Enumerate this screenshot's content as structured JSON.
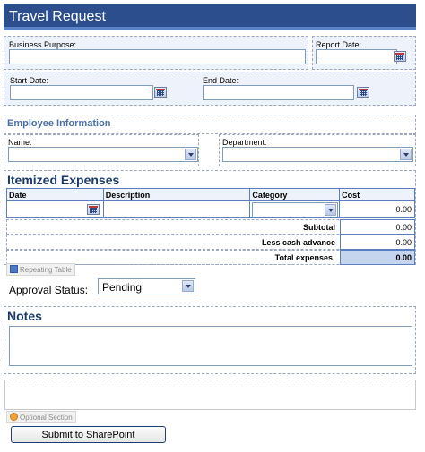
{
  "form": {
    "title": "Travel Request",
    "business_purpose_label": "Business Purpose:",
    "report_date_label": "Report Date:",
    "start_date_label": "Start Date:",
    "end_date_label": "End Date:",
    "employee_section_title": "Employee Information",
    "name_label": "Name:",
    "department_label": "Department:",
    "expenses_title": "Itemized Expenses",
    "table": {
      "headers": [
        "Date",
        "Description",
        "Category",
        "Cost"
      ],
      "rows": [
        {
          "date": "",
          "description": "",
          "category": "",
          "cost": "0.00"
        }
      ]
    },
    "summary": {
      "subtotal_label": "Subtotal",
      "subtotal_value": "0.00",
      "cash_advance_label": "Less cash advance",
      "cash_advance_value": "0.00",
      "total_label": "Total expenses",
      "total_value": "0.00"
    },
    "repeating_table_tag": "Repeating Table",
    "approval_status_label": "Approval Status:",
    "approval_status_value": "Pending",
    "notes_title": "Notes",
    "optional_section_tag": "Optional Section",
    "submit_label": "Submit to SharePoint"
  },
  "colors": {
    "title_bar": "#2c4e8d",
    "section_blue": "#4a6fa5",
    "heading_navy": "#1b3a6b",
    "table_border": "#5a7ebf"
  }
}
